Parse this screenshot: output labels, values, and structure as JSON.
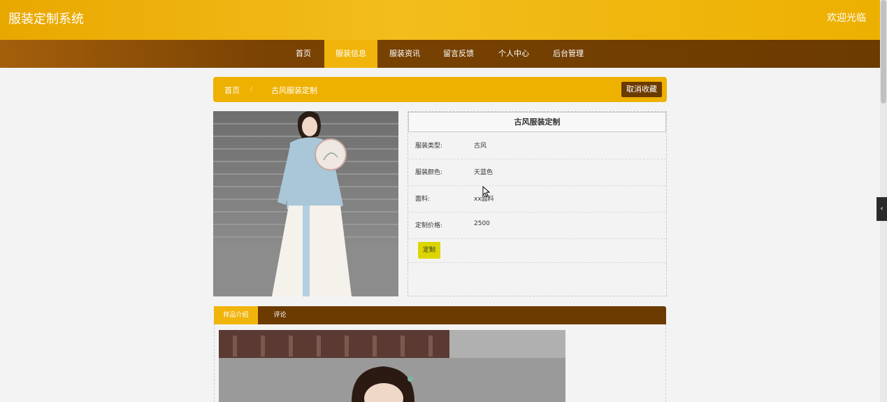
{
  "header": {
    "site_title": "服装定制系统",
    "welcome": "欢迎光临"
  },
  "nav": {
    "items": [
      {
        "label": "首页"
      },
      {
        "label": "服装信息"
      },
      {
        "label": "服装资讯"
      },
      {
        "label": "留言反馈"
      },
      {
        "label": "个人中心"
      },
      {
        "label": "后台管理"
      }
    ],
    "active": "服装信息"
  },
  "breadcrumb": {
    "home": "首页",
    "separator": "/",
    "current": "古风服装定制",
    "favorite_button": "取消收藏"
  },
  "product": {
    "title": "古风服装定制",
    "fields": [
      {
        "label": "服装类型:",
        "value": "古风"
      },
      {
        "label": "服装颜色:",
        "value": "天蓝色"
      },
      {
        "label": "面料:",
        "value": "xx面料"
      },
      {
        "label": "定制价格:",
        "value": "2500"
      }
    ],
    "custom_button": "定制"
  },
  "tabs": {
    "items": [
      {
        "label": "样品介绍"
      },
      {
        "label": "评论"
      }
    ],
    "active": "样品介绍"
  },
  "colors": {
    "header": "#f0b400",
    "nav": "#6c3b00",
    "accent": "#f1b40a",
    "custom_button": "#dcd500"
  },
  "icons": {
    "side_toggle": "chevron-left-icon",
    "cursor": "mouse-pointer-icon"
  }
}
